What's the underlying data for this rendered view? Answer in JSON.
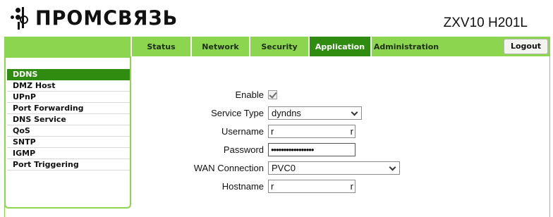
{
  "header": {
    "brand": "ПРОМСВЯЗЬ",
    "model": "ZXV10 H201L"
  },
  "nav": {
    "tabs": [
      {
        "label": "Status"
      },
      {
        "label": "Network"
      },
      {
        "label": "Security"
      },
      {
        "label": "Application",
        "active": true
      },
      {
        "label": "Administration"
      }
    ],
    "logout_label": "Logout"
  },
  "sidebar": {
    "items": [
      {
        "label": "DDNS",
        "active": true
      },
      {
        "label": "DMZ Host"
      },
      {
        "label": "UPnP"
      },
      {
        "label": "Port Forwarding"
      },
      {
        "label": "DNS Service"
      },
      {
        "label": "QoS"
      },
      {
        "label": "SNTP"
      },
      {
        "label": "IGMP"
      },
      {
        "label": "Port Triggering"
      }
    ]
  },
  "form": {
    "enable": {
      "label": "Enable",
      "checked": true
    },
    "service_type": {
      "label": "Service Type",
      "value": "dyndns"
    },
    "username": {
      "label": "Username",
      "value": "r",
      "value_right": "r"
    },
    "password": {
      "label": "Password",
      "value": "•••••••••••••••••"
    },
    "wan_connection": {
      "label": "WAN Connection",
      "value": "PVC0"
    },
    "hostname": {
      "label": "Hostname",
      "value": "r",
      "value_right": "r"
    }
  },
  "colors": {
    "nav_green": "#8bd64e",
    "active_green": "#2f8c10"
  }
}
